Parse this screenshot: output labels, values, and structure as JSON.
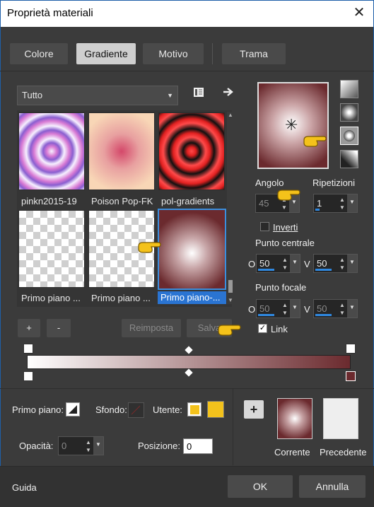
{
  "window": {
    "title": "Proprietà materiali",
    "close_glyph": "✕"
  },
  "tabs": [
    {
      "label": "Colore"
    },
    {
      "label": "Gradiente"
    },
    {
      "label": "Motivo"
    },
    {
      "label": "Trama"
    }
  ],
  "gallery": {
    "category": "Tutto",
    "items": [
      {
        "label": "pinkn2015-19"
      },
      {
        "label": "Poison Pop-FK"
      },
      {
        "label": "pol-gradients"
      },
      {
        "label": "Primo piano ..."
      },
      {
        "label": "Primo piano ..."
      },
      {
        "label": "Primo piano-..."
      }
    ],
    "add_label": "+",
    "remove_label": "-",
    "reset_label": "Reimposta",
    "save_label": "Salva"
  },
  "settings": {
    "angle_label": "Angolo",
    "angle_value": "45",
    "repeat_label": "Ripetizioni",
    "repeat_value": "1",
    "invert_label": "Inverti",
    "invert_checked": false,
    "center_label": "Punto centrale",
    "center_h_label": "O",
    "center_h_value": "50",
    "center_v_label": "V",
    "center_v_value": "50",
    "focal_label": "Punto focale",
    "focal_h_label": "O",
    "focal_h_value": "50",
    "focal_v_label": "V",
    "focal_v_value": "50",
    "link_label": "Link",
    "link_checked": true
  },
  "bottom": {
    "foreground_label": "Primo piano:",
    "background_label": "Sfondo:",
    "user_label": "Utente:",
    "user_color": "#f3c21c",
    "opacity_label": "Opacità:",
    "opacity_value": "0",
    "position_label": "Posizione:",
    "position_value": "0",
    "add_swatch_label": "+",
    "current_label": "Corrente",
    "previous_label": "Precedente"
  },
  "footer": {
    "help_label": "Guida",
    "ok_label": "OK",
    "cancel_label": "Annulla"
  },
  "colors": {
    "accent": "#2a74d2",
    "gradient_start": "#ffffff",
    "gradient_end": "#6b2a2e",
    "user_swatch": "#f3c21c"
  },
  "icons": [
    "close-icon",
    "library-icon",
    "arrow-right-icon",
    "rectangular-style-icon",
    "radial-style-icon",
    "circular-style-icon",
    "sunburst-style-icon",
    "pointer-hand-icon",
    "swap-icon"
  ]
}
